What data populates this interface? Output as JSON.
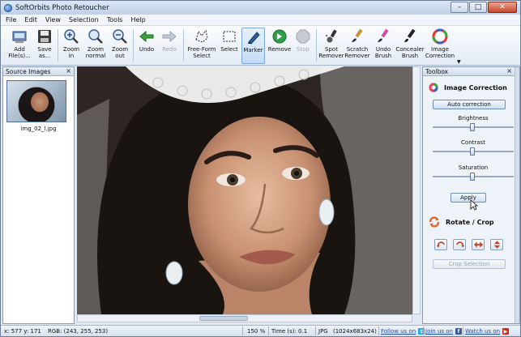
{
  "window": {
    "title": "SoftOrbits Photo Retoucher"
  },
  "menu": [
    "File",
    "Edit",
    "View",
    "Selection",
    "Tools",
    "Help"
  ],
  "toolbar": {
    "add_files": "Add\nFile(s)...",
    "save_as": "Save\nas...",
    "zoom_in": "Zoom\nin",
    "zoom_normal": "Zoom\nnormal",
    "zoom_out": "Zoom\nout",
    "undo": "Undo",
    "redo": "Redo",
    "free_form_select": "Free-Form\nSelect",
    "select": "Select",
    "marker": "Marker",
    "remove": "Remove",
    "stop": "Stop",
    "spot_remover": "Spot\nRemover",
    "scratch_remover": "Scratch\nRemover",
    "undo_brush": "Undo\nBrush",
    "concealer_brush": "Concealer\nBrush",
    "image_correction": "Image\nCorrection"
  },
  "source_panel": {
    "title": "Source Images",
    "thumb_label": "img_02_l.jpg"
  },
  "toolbox": {
    "title": "Toolbox",
    "image_correction": "Image Correction",
    "auto_correction": "Auto correction",
    "brightness": "Brightness",
    "contrast": "Contrast",
    "saturation": "Saturation",
    "apply": "Apply",
    "rotate_crop": "Rotate / Crop",
    "crop_selection": "Crop Selection"
  },
  "status": {
    "coords": "x: 577 y: 171",
    "rgb": "RGB: (243, 255, 253)",
    "zoom": "150 %",
    "time": "Time (s): 0.1",
    "format": "JPG",
    "size": "(1024x683x24)",
    "follow": "Follow us on",
    "join": "Join us on",
    "watch": "Watch us on"
  },
  "colors": {
    "accent": "#3b6fb6",
    "facebook": "#3b5998",
    "twitter": "#2aa9e0",
    "youtube": "#d12b21"
  }
}
